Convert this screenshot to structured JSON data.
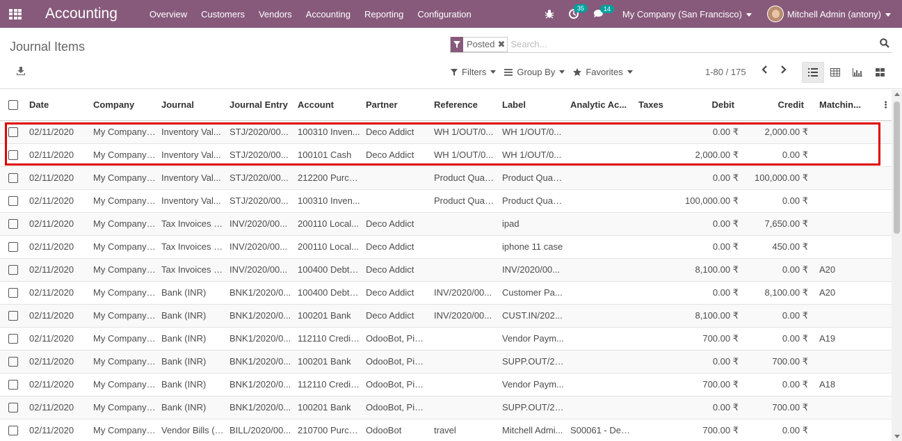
{
  "navbar": {
    "brand": "Accounting",
    "menu": [
      "Overview",
      "Customers",
      "Vendors",
      "Accounting",
      "Reporting",
      "Configuration"
    ],
    "activity_count": "35",
    "messages_count": "14",
    "company": "My Company (San Francisco)",
    "user": "Mitchell Admin (antony)"
  },
  "control": {
    "title": "Journal Items",
    "facet": "Posted",
    "search_placeholder": "Search...",
    "filters": "Filters",
    "group_by": "Group By",
    "favorites": "Favorites",
    "pager": "1-80 / 175"
  },
  "table": {
    "headers": [
      "Date",
      "Company",
      "Journal",
      "Journal Entry",
      "Account",
      "Partner",
      "Reference",
      "Label",
      "Analytic Ac...",
      "Taxes",
      "Debit",
      "Credit",
      "Matchin..."
    ],
    "rows": [
      [
        "02/11/2020",
        "My Company ...",
        "Inventory Val...",
        "STJ/2020/00...",
        "100310 Inven...",
        "Deco Addict",
        "WH 1/OUT/0...",
        "WH 1/OUT/0...",
        "",
        "",
        "0.00 ₹",
        "2,000.00 ₹",
        ""
      ],
      [
        "02/11/2020",
        "My Company ...",
        "Inventory Val...",
        "STJ/2020/00...",
        "100101 Cash",
        "Deco Addict",
        "WH 1/OUT/0...",
        "WH 1/OUT/0...",
        "",
        "",
        "2,000.00 ₹",
        "0.00 ₹",
        ""
      ],
      [
        "02/11/2020",
        "My Company ...",
        "Inventory Val...",
        "STJ/2020/00...",
        "212200 Purch...",
        "",
        "Product Quan...",
        "Product Quan...",
        "",
        "",
        "0.00 ₹",
        "100,000.00 ₹",
        ""
      ],
      [
        "02/11/2020",
        "My Company ...",
        "Inventory Val...",
        "STJ/2020/00...",
        "100310 Inven...",
        "",
        "Product Quan...",
        "Product Quan...",
        "",
        "",
        "100,000.00 ₹",
        "0.00 ₹",
        ""
      ],
      [
        "02/11/2020",
        "My Company ...",
        "Tax Invoices (...",
        "INV/2020/00...",
        "200110 Local...",
        "Deco Addict",
        "",
        "ipad",
        "",
        "",
        "0.00 ₹",
        "7,650.00 ₹",
        ""
      ],
      [
        "02/11/2020",
        "My Company ...",
        "Tax Invoices (...",
        "INV/2020/00...",
        "200110 Local...",
        "Deco Addict",
        "",
        "iphone 11 case",
        "",
        "",
        "0.00 ₹",
        "450.00 ₹",
        ""
      ],
      [
        "02/11/2020",
        "My Company ...",
        "Tax Invoices (...",
        "INV/2020/00...",
        "100400 Debto...",
        "Deco Addict",
        "",
        "INV/2020/00...",
        "",
        "",
        "8,100.00 ₹",
        "0.00 ₹",
        "A20"
      ],
      [
        "02/11/2020",
        "My Company ...",
        "Bank (INR)",
        "BNK1/2020/0...",
        "100400 Debto...",
        "Deco Addict",
        "INV/2020/00...",
        "Customer Pa...",
        "",
        "",
        "0.00 ₹",
        "8,100.00 ₹",
        "A20"
      ],
      [
        "02/11/2020",
        "My Company ...",
        "Bank (INR)",
        "BNK1/2020/0...",
        "100201 Bank",
        "Deco Addict",
        "INV/2020/00...",
        "CUST.IN/202...",
        "",
        "",
        "8,100.00 ₹",
        "0.00 ₹",
        ""
      ],
      [
        "02/11/2020",
        "My Company ...",
        "Bank (INR)",
        "BNK1/2020/0...",
        "112110 Credit...",
        "OdooBot, Piet...",
        "",
        "Vendor Paym...",
        "",
        "",
        "700.00 ₹",
        "0.00 ₹",
        "A19"
      ],
      [
        "02/11/2020",
        "My Company ...",
        "Bank (INR)",
        "BNK1/2020/0...",
        "100201 Bank",
        "OdooBot, Piet...",
        "",
        "SUPP.OUT/20...",
        "",
        "",
        "0.00 ₹",
        "700.00 ₹",
        ""
      ],
      [
        "02/11/2020",
        "My Company ...",
        "Bank (INR)",
        "BNK1/2020/0...",
        "112110 Credit...",
        "OdooBot, Piet...",
        "",
        "Vendor Paym...",
        "",
        "",
        "700.00 ₹",
        "0.00 ₹",
        "A18"
      ],
      [
        "02/11/2020",
        "My Company ...",
        "Bank (INR)",
        "BNK1/2020/0...",
        "100201 Bank",
        "OdooBot, Piet...",
        "",
        "SUPP.OUT/20...",
        "",
        "",
        "0.00 ₹",
        "700.00 ₹",
        ""
      ],
      [
        "02/11/2020",
        "My Company ...",
        "Vendor Bills (I...",
        "BILL/2020/00...",
        "210700 Purch...",
        "OdooBot",
        "travel",
        "Mitchell Admi...",
        "S00061 - Dec...",
        "",
        "700.00 ₹",
        "0.00 ₹",
        ""
      ]
    ]
  },
  "colors": {
    "brand": "#875a7b",
    "badge": "#00a09d",
    "highlight": "#e00000"
  }
}
